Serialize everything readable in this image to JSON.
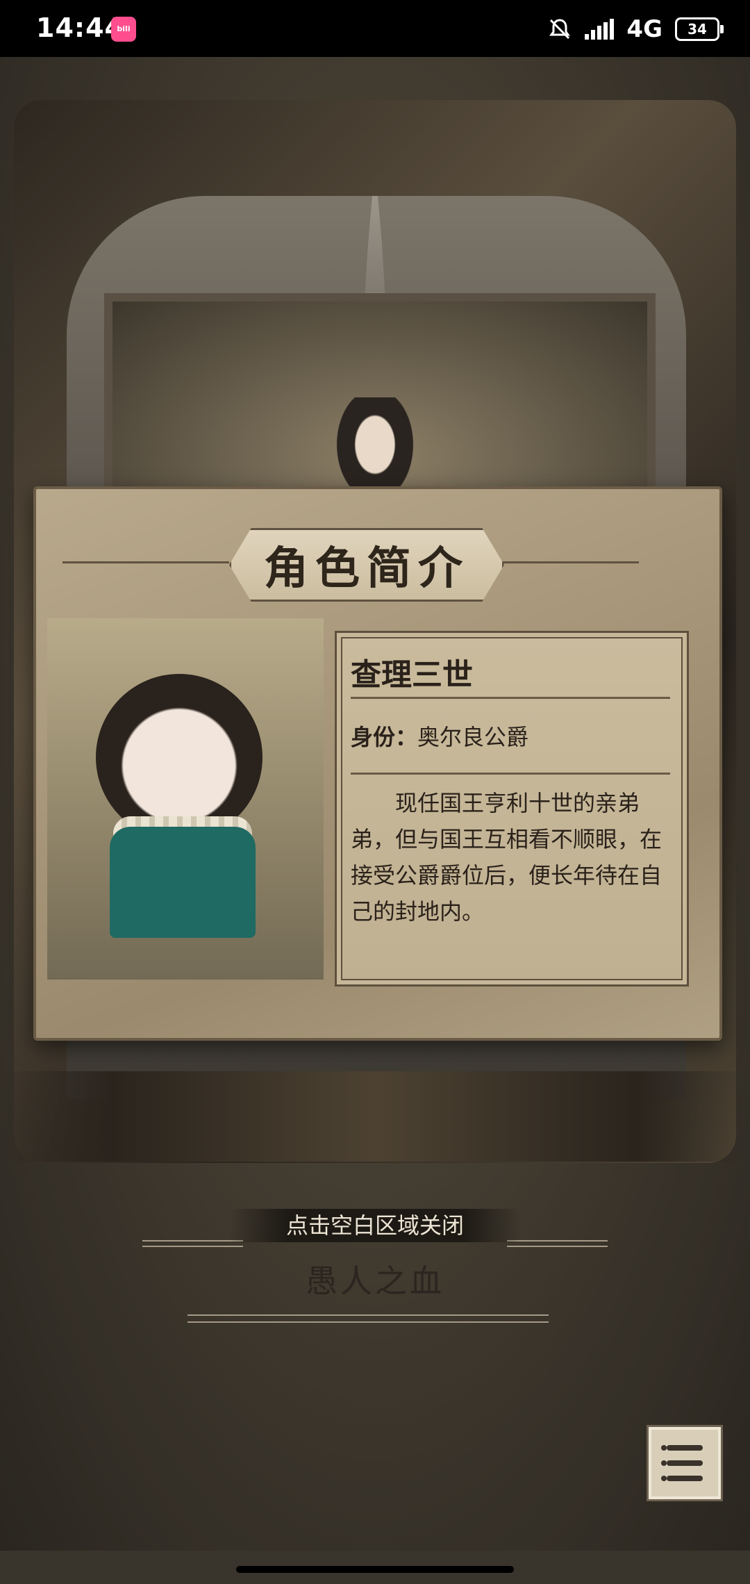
{
  "status_bar": {
    "time": "14:44",
    "network": "4G",
    "battery": "34",
    "icons": [
      "app-badge-icon",
      "mute-bell-icon",
      "signal-icon",
      "battery-icon"
    ]
  },
  "card": {
    "title": "角色简介",
    "character_name": "查理三世",
    "identity_label": "身份：",
    "identity_value": "奥尔良公爵",
    "description": "现任国王亨利十世的亲弟弟，但与国王互相看不顺眼，在接受公爵爵位后，便长年待在自己的封地内。"
  },
  "hint": {
    "close_text": "点击空白区域关闭",
    "chapter_title": "愚人之血"
  },
  "controls": {
    "menu_icon": "list-menu-icon"
  }
}
